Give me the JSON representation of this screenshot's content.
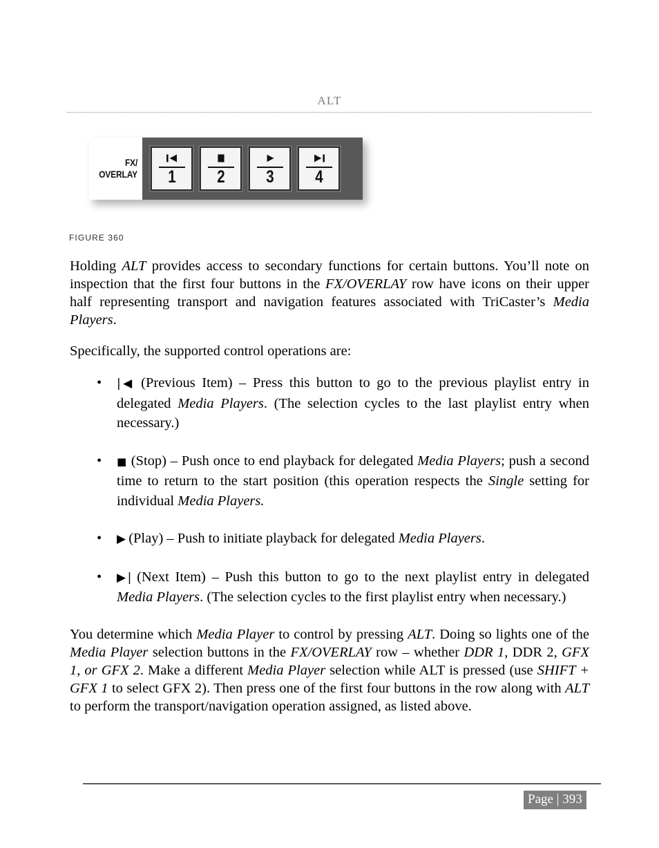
{
  "header": {
    "title": "ALT"
  },
  "figure": {
    "caption": "FIGURE 360",
    "panel": {
      "label_line1": "FX/",
      "label_line2": "OVERLAY",
      "panel_color": "#585858",
      "label_bg_color": "#ffffff",
      "button_face_color": "#f4f4f4",
      "buttons": [
        {
          "number": "1",
          "icon": "previous-item-icon",
          "glyph": "|◀"
        },
        {
          "number": "2",
          "icon": "stop-icon",
          "glyph": "■"
        },
        {
          "number": "3",
          "icon": "play-icon",
          "glyph": "▶"
        },
        {
          "number": "4",
          "icon": "next-item-icon",
          "glyph": "▶|"
        }
      ]
    }
  },
  "body": {
    "paragraph1": {
      "part1": "Holding ",
      "em1": "ALT",
      "part2": " provides access to secondary functions for certain buttons.  You’ll note on inspection that the first four buttons in the ",
      "em2": "FX/OVERLAY",
      "part3": " row have icons on their upper half representing transport and navigation features associated with TriCaster’s ",
      "em3": "Media Players",
      "part4": "."
    },
    "paragraph2": "Specifically, the supported control operations are:",
    "bullets": [
      {
        "glyph": "|◀",
        "icon": "previous-item-icon",
        "part1": " (Previous Item) – Press this button to go to the previous playlist entry in delegated ",
        "em1": "Media Players",
        "part2": ". (The selection cycles to the last playlist entry when necessary.)"
      },
      {
        "glyph": "■",
        "icon": "stop-icon",
        "part1": "  (Stop) – Push once to end playback for delegated ",
        "em1": "Media Players",
        "part2": "; push a second time to return to the start position (this operation respects the ",
        "em2": "Single",
        "part3": " setting for individual ",
        "em3": "Media Players.",
        "part4": ""
      },
      {
        "glyph": "▶",
        "icon": "play-icon",
        "part1": "  (Play) – Push to initiate playback for delegated ",
        "em1": "Media Players",
        "part2": "."
      },
      {
        "glyph": "▶|",
        "icon": "next-item-icon",
        "part1": " (Next Item) – Push this button to go to the next playlist entry in delegated ",
        "em1": "Media Players",
        "part2": ". (The selection cycles to the first playlist entry when necessary.)"
      }
    ],
    "paragraph3": {
      "part1": "You determine which ",
      "em1": "Media Player",
      "part2": " to control by pressing ",
      "em2": "ALT",
      "part3": ".  Doing so lights one of the ",
      "em3": "Media Player",
      "part4": " selection buttons in the ",
      "em4": "FX/OVERLAY",
      "part5": " row – whether ",
      "em5": "DDR 1",
      "part6": ", DDR 2, ",
      "em6": "GFX 1, or GFX 2",
      "part7": ".  Make a different ",
      "em7": "Media Player",
      "part8": " selection while ALT is pressed (use ",
      "em8": "SHIFT + GFX 1",
      "part9": " to select GFX 2).  Then press one of the first four buttons in the row along with ",
      "em9": "ALT",
      "part10": " to perform the transport/navigation operation assigned, as listed above."
    }
  },
  "footer": {
    "page_label": "Page | 393",
    "badge_bg_color": "#808080",
    "rule_color": "#5d5d5d"
  }
}
